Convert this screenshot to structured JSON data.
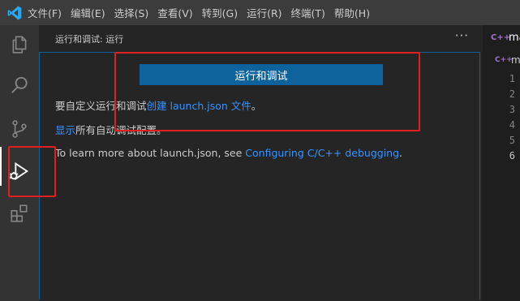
{
  "menu": [
    "文件(F)",
    "编辑(E)",
    "选择(S)",
    "查看(V)",
    "转到(G)",
    "运行(R)",
    "终端(T)",
    "帮助(H)"
  ],
  "sidebar": {
    "title": "运行和调试: 运行",
    "more": "···",
    "run_button": "运行和调试",
    "line1_prefix": "要自定义运行和调试",
    "line1_link": "创建 launch.json 文件",
    "line1_suffix": "。",
    "line2_link": "显示",
    "line2_suffix": "所有自动调试配置。",
    "line3_prefix": "To learn more about launch.json, see ",
    "line3_link": "Configuring C/C++ debugging",
    "line3_suffix": "."
  },
  "editor": {
    "tab_icon": "C++",
    "tab_label": "ma",
    "breadcrumb_icon": "C++",
    "breadcrumb_label": "m",
    "line_numbers": [
      "1",
      "2",
      "3",
      "4",
      "5",
      "6"
    ]
  },
  "icons": [
    "vscode-logo-icon",
    "files-icon",
    "search-icon",
    "source-control-icon",
    "run-debug-icon",
    "extensions-icon"
  ],
  "colors": {
    "accent": "#0e639c",
    "link": "#3794ff",
    "annotation": "#e02020"
  }
}
